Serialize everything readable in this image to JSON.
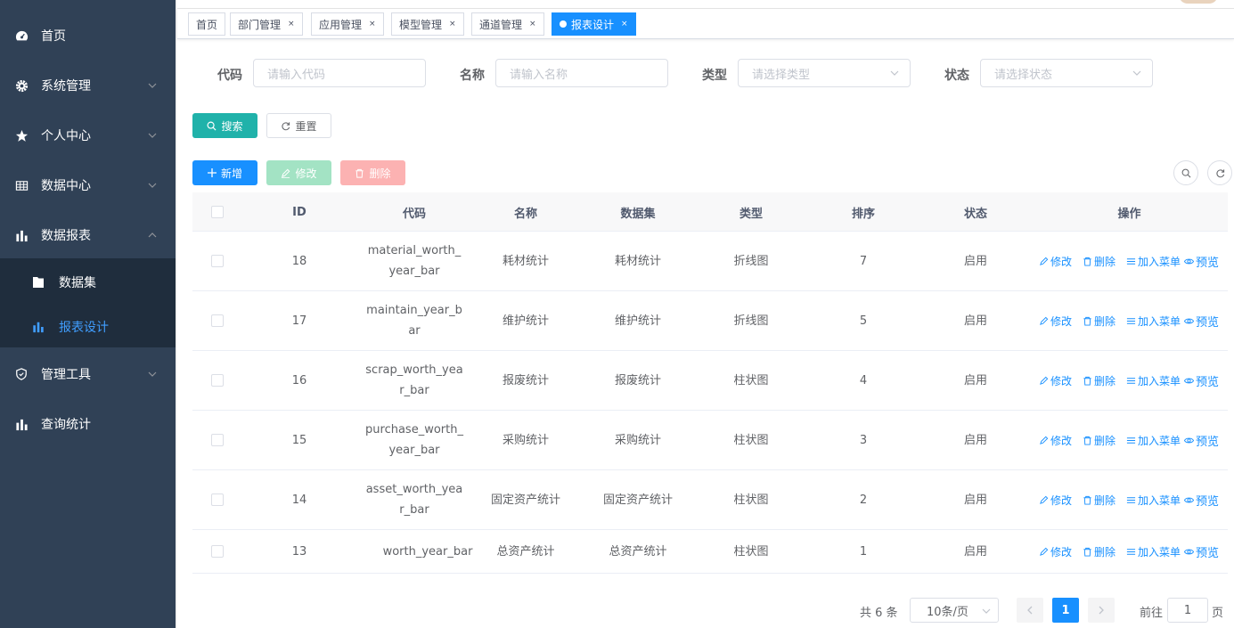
{
  "sidebar": {
    "items": [
      {
        "label": "首页",
        "icon": "dashboard-icon"
      },
      {
        "label": "系统管理",
        "icon": "gear-icon"
      },
      {
        "label": "个人中心",
        "icon": "star-icon"
      },
      {
        "label": "数据中心",
        "icon": "table-icon"
      },
      {
        "label": "数据报表",
        "icon": "bar-chart-icon"
      },
      {
        "label": "管理工具",
        "icon": "shield-icon"
      },
      {
        "label": "查询统计",
        "icon": "bar-chart-icon"
      }
    ],
    "subitems": [
      {
        "label": "数据集",
        "icon": "folder-icon"
      },
      {
        "label": "报表设计",
        "icon": "bar-chart-icon",
        "active": true
      }
    ]
  },
  "tags": [
    {
      "label": "首页"
    },
    {
      "label": "部门管理",
      "close": "×"
    },
    {
      "label": "应用管理",
      "close": "×"
    },
    {
      "label": "模型管理",
      "close": "×"
    },
    {
      "label": "通道管理",
      "close": "×"
    },
    {
      "label": "报表设计",
      "close": "×",
      "active": true
    }
  ],
  "filters": {
    "code_label": "代码",
    "code_placeholder": "请输入代码",
    "name_label": "名称",
    "name_placeholder": "请输入名称",
    "type_label": "类型",
    "type_placeholder": "请选择类型",
    "status_label": "状态",
    "status_placeholder": "请选择状态"
  },
  "buttons": {
    "search": "搜索",
    "reset": "重置",
    "add": "新增",
    "edit": "修改",
    "delete": "删除"
  },
  "table": {
    "headers": [
      "ID",
      "代码",
      "名称",
      "数据集",
      "类型",
      "排序",
      "状态",
      "操作"
    ],
    "rows": [
      {
        "id": "18",
        "code": "material_worth_year_bar",
        "name": "耗材统计",
        "dataset": "耗材统计",
        "type": "折线图",
        "sort": "7",
        "status": "启用"
      },
      {
        "id": "17",
        "code": "maintain_year_bar",
        "name": "维护统计",
        "dataset": "维护统计",
        "type": "折线图",
        "sort": "5",
        "status": "启用"
      },
      {
        "id": "16",
        "code": "scrap_worth_year_bar",
        "name": "报废统计",
        "dataset": "报废统计",
        "type": "柱状图",
        "sort": "4",
        "status": "启用"
      },
      {
        "id": "15",
        "code": "purchase_worth_year_bar",
        "name": "采购统计",
        "dataset": "采购统计",
        "type": "柱状图",
        "sort": "3",
        "status": "启用"
      },
      {
        "id": "14",
        "code": "asset_worth_year_bar",
        "name": "固定资产统计",
        "dataset": "固定资产统计",
        "type": "柱状图",
        "sort": "2",
        "status": "启用"
      },
      {
        "id": "13",
        "code": "worth_year_bar",
        "name": "总资产统计",
        "dataset": "总资产统计",
        "type": "柱状图",
        "sort": "1",
        "status": "启用"
      }
    ],
    "ops": {
      "edit": "修改",
      "delete": "删除",
      "add_menu": "加入菜单",
      "preview": "预览"
    }
  },
  "pagination": {
    "total": "共 6 条",
    "page_size": "10条/页",
    "current": "1",
    "goto_label": "前往",
    "goto_value": "1",
    "page_suffix": "页"
  }
}
